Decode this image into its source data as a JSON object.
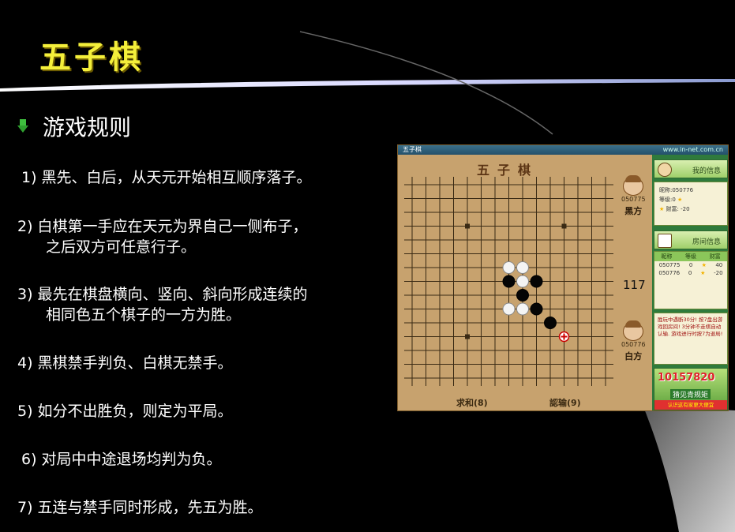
{
  "slide": {
    "title": "五子棋",
    "section_title": "游戏规则",
    "rules": [
      {
        "line1": "1) 黑先、白后，从天元开始相互顺序落子。",
        "line2": ""
      },
      {
        "line1": "2) 白棋第一手应在天元为界自己一侧布子，",
        "line2": "之后双方可任意行子。"
      },
      {
        "line1": "3) 最先在棋盘横向、竖向、斜向形成连续的",
        "line2": "相同色五个棋子的一方为胜。"
      },
      {
        "line1": "4) 黑棋禁手判负、白棋无禁手。",
        "line2": ""
      },
      {
        "line1": "5) 如分不出胜负，则定为平局。",
        "line2": ""
      },
      {
        "line1": "6) 对局中中途退场均判为负。",
        "line2": ""
      },
      {
        "line1": "7) 五连与禁手同时形成，先五为胜。",
        "line2": ""
      }
    ]
  },
  "game": {
    "window_title": "五子棋",
    "site": "www.in-net.com.cn",
    "board_title": "五子棋",
    "black_player": {
      "id": "050775",
      "side": "黑方"
    },
    "white_player": {
      "id": "050776",
      "side": "白方"
    },
    "move_count": "117",
    "draw_label": "求和(8)",
    "resign_label": "認输(9)",
    "my_info": {
      "header": "我的信息",
      "nickname": "昵称:050776",
      "level": "等级:0",
      "wealth": "财富: -20"
    },
    "room_info": {
      "header": "房间信息",
      "columns": [
        "昵称",
        "等级",
        "财富"
      ],
      "rows": [
        {
          "name": "050775",
          "level": "0",
          "wealth": "40"
        },
        {
          "name": "050776",
          "level": "0",
          "wealth": "-20"
        }
      ]
    },
    "message": "胜玩中遇断30分! 按7盘出游戏回房间! 3分钟不走棋自动认输. 游戏进行时按7为退局!",
    "ad": {
      "number": "10157820",
      "sub": "猜见青规矩",
      "footer": "认识这有家更大便宜"
    }
  },
  "colors": {
    "title": "#f4ef3a",
    "board": "#c7a26e",
    "panel_green": "#2f7a3c"
  },
  "icons": {
    "bullet": "green-arrow-bullet-icon"
  }
}
